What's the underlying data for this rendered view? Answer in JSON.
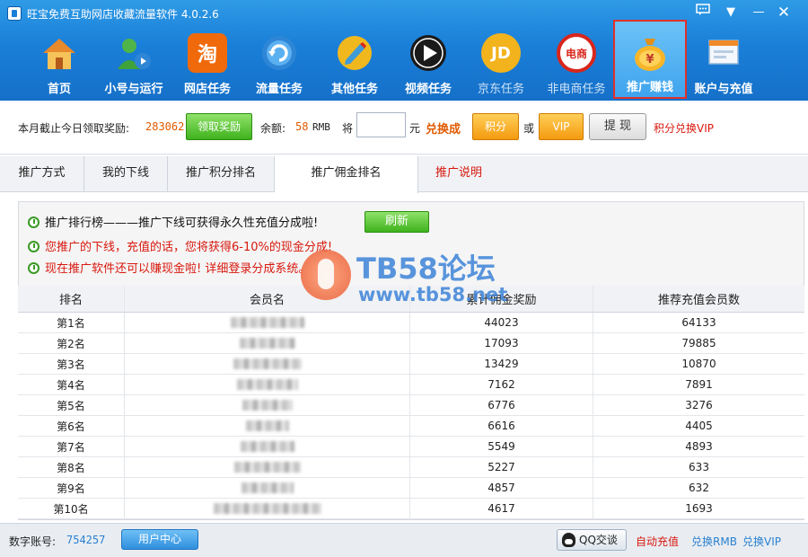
{
  "app": {
    "title": "旺宝免费互助网店收藏流量软件 4.0.2.6"
  },
  "window_controls": [
    "message-icon",
    "menu-down-icon",
    "minimize-icon",
    "close-icon"
  ],
  "nav": [
    {
      "label": "首页",
      "icon": "home-icon",
      "color": "#e8892b"
    },
    {
      "label": "小号与运行",
      "icon": "user-run-icon",
      "color": "#3fa23a"
    },
    {
      "label": "网店任务",
      "icon": "taobao-icon",
      "color": "#f06a0c",
      "glyph": "淘"
    },
    {
      "label": "流量任务",
      "icon": "refresh-flow-icon",
      "color": "#2f86d6"
    },
    {
      "label": "其他任务",
      "icon": "pencil-task-icon",
      "color": "#f1b81e"
    },
    {
      "label": "视频任务",
      "icon": "play-video-icon",
      "color": "#1a1a1a"
    },
    {
      "label": "京东任务",
      "icon": "jd-icon",
      "color": "#f2b31d",
      "glyph": "JD"
    },
    {
      "label": "非电商任务",
      "icon": "no-ecommerce-icon",
      "color": "#d8261c",
      "glyph": "电商"
    },
    {
      "label": "推广赚钱",
      "icon": "money-bag-icon",
      "color": "#f2a416",
      "glyph": "¥"
    },
    {
      "label": "账户与充值",
      "icon": "account-window-icon",
      "color": "#e8eef6"
    }
  ],
  "reward": {
    "month_label": "本月截止今日领取奖励:",
    "month_value": "283062",
    "claim_button": "领取奖励",
    "balance_label": "余额:",
    "balance_value": "58",
    "balance_unit": "RMB",
    "convert_prefix": "将",
    "amount_value": "",
    "yuan": "元",
    "convert_to": "兑换成",
    "points_button": "积分",
    "or": "或",
    "vip_button": "VIP",
    "withdraw_button": "提 现",
    "points_vip_link": "积分兑换VIP"
  },
  "tabs": [
    "推广方式",
    "我的下线",
    "推广积分排名",
    "推广佣金排名",
    "推广说明"
  ],
  "info": {
    "line1": "推广排行榜———推广下线可获得永久性充值分成啦!",
    "refresh_button": "刷新",
    "line2": "您推广的下线，充值的话，您将获得6-10%的现金分成!",
    "line3": "现在推广软件还可以赚现金啦! 详细登录分成系统。"
  },
  "watermark": {
    "title": "TB58论坛",
    "url": "www.tb58.net"
  },
  "table": {
    "headers": [
      "排名",
      "会员名",
      "累计佣金奖励",
      "推荐充值会员数"
    ],
    "rows": [
      {
        "rank": "第1名",
        "reward": "44023",
        "members": "64133"
      },
      {
        "rank": "第2名",
        "reward": "17093",
        "members": "79885"
      },
      {
        "rank": "第3名",
        "reward": "13429",
        "members": "10870"
      },
      {
        "rank": "第4名",
        "reward": "7162",
        "members": "7891"
      },
      {
        "rank": "第5名",
        "reward": "6776",
        "members": "3276"
      },
      {
        "rank": "第6名",
        "reward": "6616",
        "members": "4405"
      },
      {
        "rank": "第7名",
        "reward": "5549",
        "members": "4893"
      },
      {
        "rank": "第8名",
        "reward": "5227",
        "members": "633"
      },
      {
        "rank": "第9名",
        "reward": "4857",
        "members": "632"
      },
      {
        "rank": "第10名",
        "reward": "4617",
        "members": "1693"
      }
    ]
  },
  "status": {
    "account_label": "数字账号:",
    "account_value": "754257",
    "user_center_button": "用户中心",
    "qq_button": "QQ交谈",
    "auto_recharge": "自动充值",
    "exchange_rmb": "兑换RMB",
    "exchange_vip": "兑换VIP"
  }
}
